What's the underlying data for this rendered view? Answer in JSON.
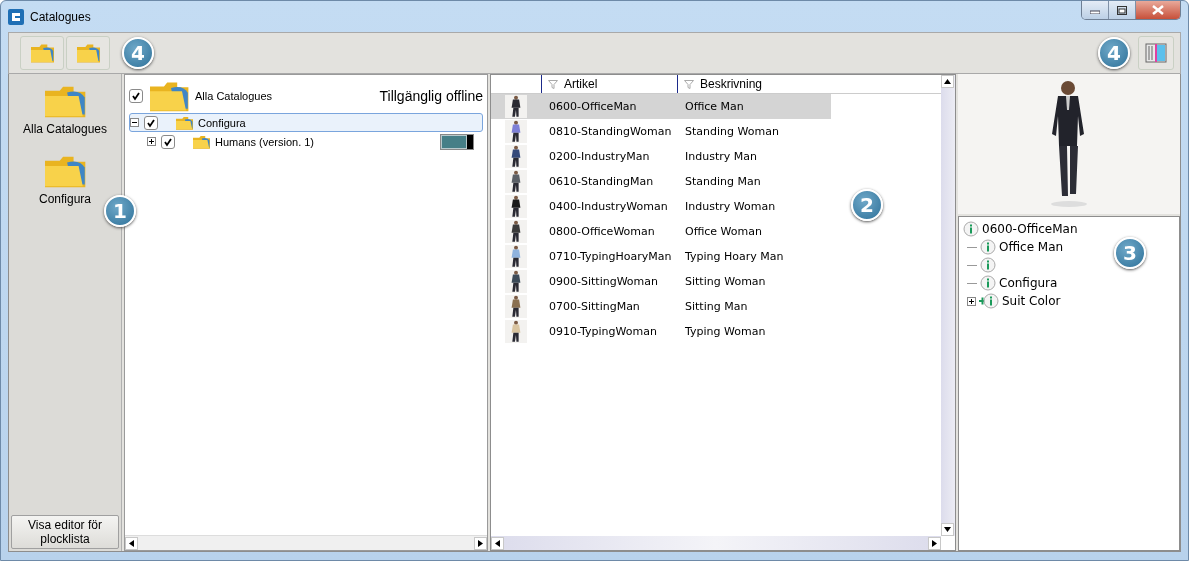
{
  "window": {
    "title": "Catalogues"
  },
  "toolbar": {
    "callout": "4",
    "right_callout": "4"
  },
  "sidebar": {
    "items": [
      {
        "label": "Alla Catalogues",
        "selected": false
      },
      {
        "label": "Configura",
        "selected": false
      }
    ],
    "callout": "1",
    "button": "Visa editor för plocklista"
  },
  "catalog_tree": {
    "header": "Tillgänglig offline",
    "root": {
      "label": "Alla Catalogues",
      "checked": true,
      "children": [
        {
          "label": "Configura",
          "checked": true,
          "expanded": true,
          "selected": true,
          "children": [
            {
              "label": "Humans (version. 1)",
              "checked": true,
              "expanded": false,
              "selected": false,
              "level": 0.82
            }
          ]
        }
      ]
    }
  },
  "article_list": {
    "columns": [
      "Artikel",
      "Beskrivning"
    ],
    "callout": "2",
    "rows": [
      {
        "article": "0600-OfficeMan",
        "description": "Office Man",
        "selected": true
      },
      {
        "article": "0810-StandingWoman",
        "description": "Standing Woman",
        "selected": false
      },
      {
        "article": "0200-IndustryMan",
        "description": "Industry Man",
        "selected": false
      },
      {
        "article": "0610-StandingMan",
        "description": "Standing Man",
        "selected": false
      },
      {
        "article": "0400-IndustryWoman",
        "description": "Industry Woman",
        "selected": false
      },
      {
        "article": "0800-OfficeWoman",
        "description": "Office Woman",
        "selected": false
      },
      {
        "article": "0710-TypingHoaryMan",
        "description": "Typing Hoary Man",
        "selected": false
      },
      {
        "article": "0900-SittingWoman",
        "description": "Sitting Woman",
        "selected": false
      },
      {
        "article": "0700-SittingMan",
        "description": "Sitting Man",
        "selected": false
      },
      {
        "article": "0910-TypingWoman",
        "description": "Typing Woman",
        "selected": false
      }
    ]
  },
  "properties": {
    "callout": "3",
    "tree": {
      "label": "0600-OfficeMan",
      "kind": "info",
      "children": [
        {
          "label": "Office Man",
          "kind": "info"
        },
        {
          "kind": "info"
        },
        {
          "label": "Configura",
          "kind": "info"
        },
        {
          "label": "Suit Color",
          "kind": "feature",
          "expanded": false
        }
      ]
    }
  }
}
